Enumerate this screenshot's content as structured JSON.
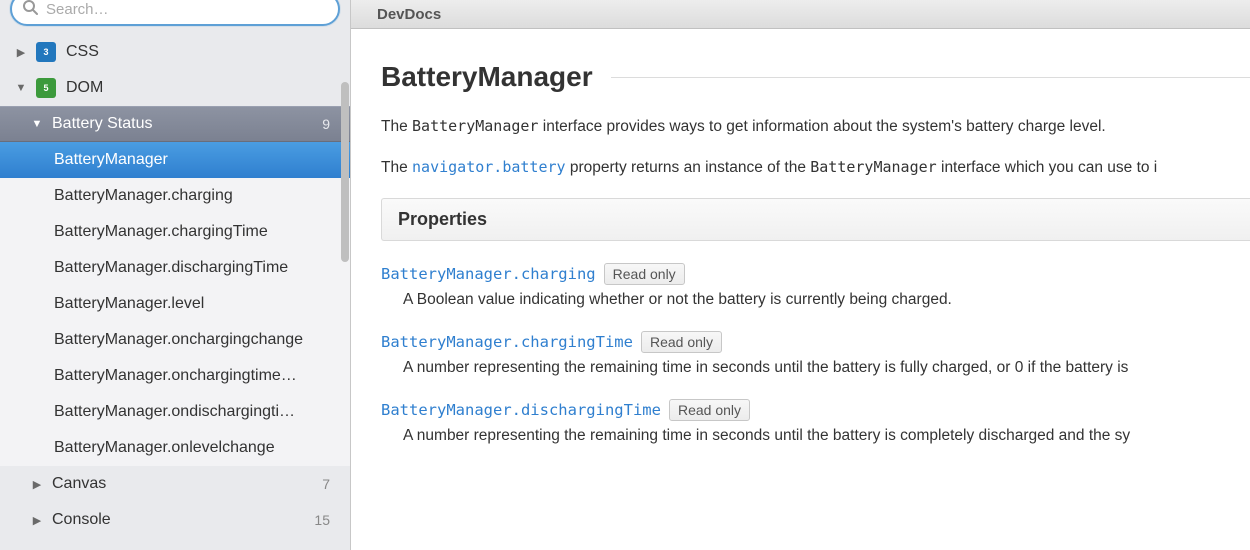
{
  "search": {
    "placeholder": "Search…"
  },
  "topbar": {
    "title": "DevDocs"
  },
  "sidebar": {
    "items": [
      {
        "kind": "doc",
        "label": "CSS",
        "icon": "css",
        "expanded": false
      },
      {
        "kind": "doc",
        "label": "DOM",
        "icon": "dom",
        "expanded": true
      },
      {
        "kind": "category",
        "label": "Battery Status",
        "count": "9",
        "active": true
      },
      {
        "kind": "entry",
        "label": "BatteryManager",
        "active": true
      },
      {
        "kind": "entry",
        "label": "BatteryManager.charging"
      },
      {
        "kind": "entry",
        "label": "BatteryManager.chargingTime"
      },
      {
        "kind": "entry",
        "label": "BatteryManager.dischargingTime"
      },
      {
        "kind": "entry",
        "label": "BatteryManager.level"
      },
      {
        "kind": "entry",
        "label": "BatteryManager.onchargingchange"
      },
      {
        "kind": "entry",
        "label": "BatteryManager.onchargingtime…"
      },
      {
        "kind": "entry",
        "label": "BatteryManager.ondischargingti…"
      },
      {
        "kind": "entry",
        "label": "BatteryManager.onlevelchange"
      },
      {
        "kind": "category",
        "label": "Canvas",
        "count": "7"
      },
      {
        "kind": "category",
        "label": "Console",
        "count": "15"
      }
    ]
  },
  "article": {
    "title": "BatteryManager",
    "intro1_pre": "The ",
    "intro1_code": "BatteryManager",
    "intro1_post": " interface provides ways to get information about the system's battery charge level.",
    "intro2_pre": "The ",
    "intro2_link": "navigator.battery",
    "intro2_mid": " property returns an instance of the ",
    "intro2_code": "BatteryManager",
    "intro2_post": " interface which you can use to i",
    "section_properties": "Properties",
    "readonly_label": "Read only",
    "props": [
      {
        "name": "BatteryManager.charging",
        "desc": "A Boolean value indicating whether or not the battery is currently being charged."
      },
      {
        "name": "BatteryManager.chargingTime",
        "desc": "A number representing the remaining time in seconds until the battery is fully charged, or 0 if the battery is"
      },
      {
        "name": "BatteryManager.dischargingTime",
        "desc": "A number representing the remaining time in seconds until the battery is completely discharged and the sy"
      }
    ]
  }
}
